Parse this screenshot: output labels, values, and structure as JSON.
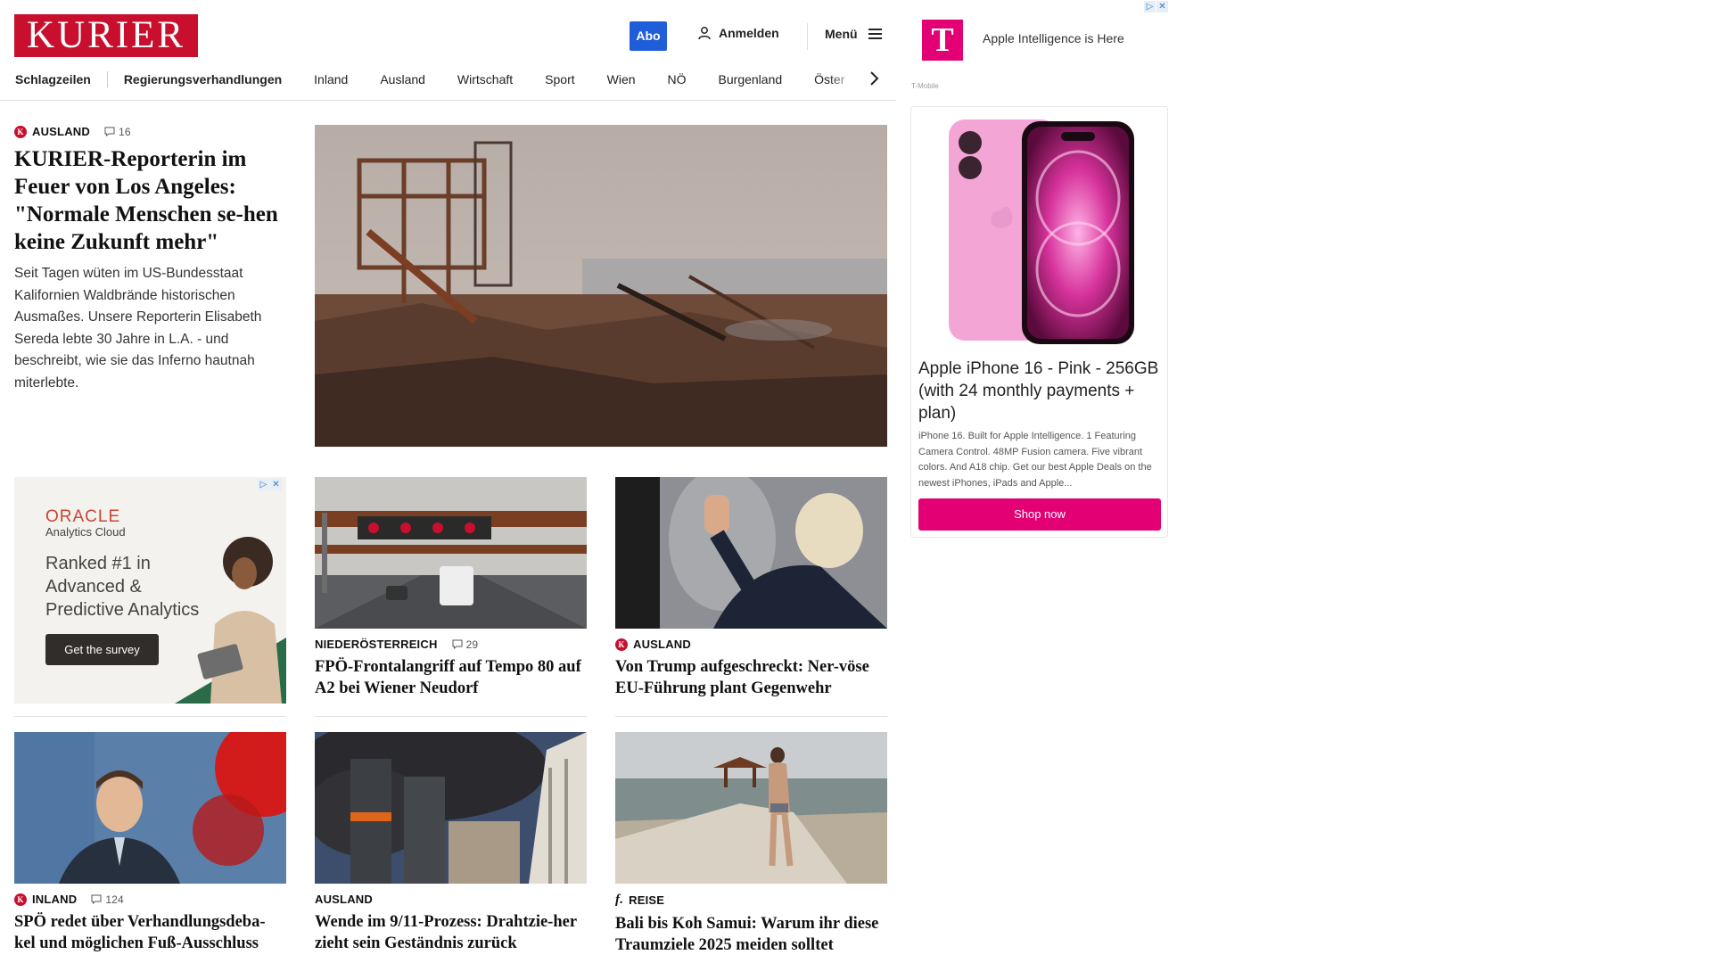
{
  "header": {
    "logo": "KURIER",
    "abo_label": "Abo",
    "login_label": "Anmelden",
    "menu_label": "Menü"
  },
  "nav": {
    "items": [
      "Schlagzeilen",
      "Regierungsverhandlungen",
      "Inland",
      "Ausland",
      "Wirtschaft",
      "Sport",
      "Wien",
      "NÖ",
      "Burgenland",
      "Öster"
    ]
  },
  "lead": {
    "kicker": "AUSLAND",
    "comments": "16",
    "headline": "KURIER-Reporterin im Feuer von Los Angeles: \"Normale Menschen se-hen keine Zukunft mehr\"",
    "teaser": "Seit Tagen wüten im US-Bundesstaat Kalifornien Waldbrände historischen Ausmaßes. Unsere Reporterin Elisabeth Sereda lebte 30 Jahre in L.A. - und beschreibt, wie sie das Inferno hautnah miterlebte."
  },
  "ad_oracle": {
    "brand": "ORACLE",
    "sub": "Analytics Cloud",
    "pitch": "Ranked #1 in Advanced & Predictive Analytics",
    "button": "Get the survey"
  },
  "cards": [
    {
      "kicker": "NIEDERÖSTERREICH",
      "comments": "29",
      "headline": "FPÖ-Frontalangriff auf Tempo 80 auf A2 bei Wiener Neudorf"
    },
    {
      "kicker": "AUSLAND",
      "comments": "",
      "headline": "Von Trump aufgeschreckt: Ner-vöse EU-Führung plant Gegenwehr"
    },
    {
      "kicker": "INLAND",
      "comments": "124",
      "headline": "SPÖ redet über Verhandlungsdeba-kel und möglichen Fuß-Ausschluss"
    },
    {
      "kicker": "AUSLAND",
      "comments": "",
      "headline": "Wende im 9/11-Prozess: Drahtzie-her zieht sein Geständnis zurück"
    },
    {
      "kicker": "REISE",
      "comments": "",
      "headline": "Bali bis Koh Samui: Warum ihr diese Traumziele 2025 meiden solltet"
    }
  ],
  "ad_tmobile": {
    "headline": "Apple Intelligence is Here",
    "brand": "T-Mobile",
    "product_title": "Apple iPhone 16 - Pink - 256GB (with 24 monthly payments + plan)",
    "product_desc": "iPhone 16. Built for Apple Intelligence. 1 Featuring Camera Control. 48MP Fusion camera. Five vibrant colors. And A18 chip. Get our best Apple Deals on the newest iPhones, iPads and Apple...",
    "shop_label": "Shop now"
  },
  "colors": {
    "brand_red": "#c8102e",
    "abo_blue": "#1f5dd9",
    "tmobile_magenta": "#e20074"
  }
}
